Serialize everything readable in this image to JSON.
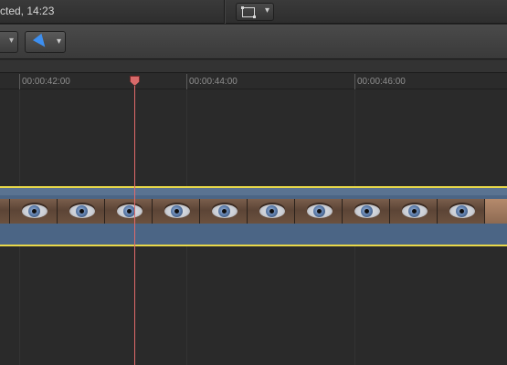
{
  "header": {
    "status_text": "cted, 14:23"
  },
  "toolbar": {
    "crop_icon": "crop-rectangle-icon",
    "select_tool_icon": "arrow-pointer-icon",
    "chevron": "▾"
  },
  "ruler": {
    "timecodes": [
      "00:00:42:00",
      "00:00:44:00",
      "00:00:46:00"
    ]
  },
  "colors": {
    "accent": "#3d8ff0",
    "playhead": "#e06a6a",
    "clip_fill": "#4b6585",
    "clip_selection": "#e8d84a"
  }
}
